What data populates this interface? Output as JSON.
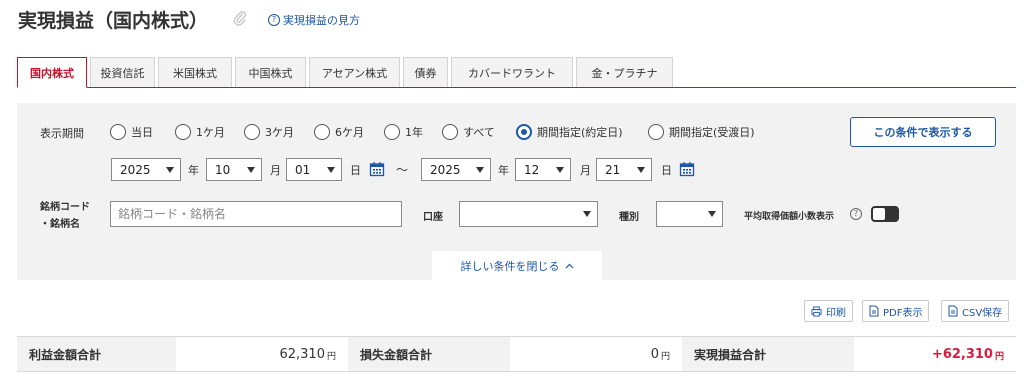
{
  "header": {
    "title": "実現損益（国内株式）",
    "help_link": "実現損益の見方"
  },
  "tabs": [
    {
      "label": "国内株式",
      "active": true
    },
    {
      "label": "投資信託"
    },
    {
      "label": "米国株式"
    },
    {
      "label": "中国株式"
    },
    {
      "label": "アセアン株式"
    },
    {
      "label": "債券"
    },
    {
      "label": "カバードワラント"
    },
    {
      "label": "金・プラチナ"
    }
  ],
  "filters": {
    "period_label": "表示期間",
    "period_options": [
      {
        "label": "当日",
        "selected": false
      },
      {
        "label": "1ケ月",
        "selected": false
      },
      {
        "label": "3ケ月",
        "selected": false
      },
      {
        "label": "6ケ月",
        "selected": false
      },
      {
        "label": "1年",
        "selected": false
      },
      {
        "label": "すべて",
        "selected": false
      },
      {
        "label": "期間指定(約定日)",
        "selected": true
      },
      {
        "label": "期間指定(受渡日)",
        "selected": false
      }
    ],
    "apply_button": "この条件で表示する",
    "date_from": {
      "year": "2025",
      "month": "10",
      "day": "01"
    },
    "date_to": {
      "year": "2025",
      "month": "12",
      "day": "21"
    },
    "unit_year": "年",
    "unit_month": "月",
    "unit_day": "日",
    "range_sep": "～",
    "symbol_label_1": "銘柄コード",
    "symbol_label_2": "・銘柄名",
    "symbol_placeholder": "銘柄コード・銘柄名",
    "account_label": "口座",
    "account_value": "",
    "category_label": "種別",
    "category_value": "",
    "decimal_label": "平均取得価額小数表示",
    "decimal_toggle_on": true,
    "collapse_label": "詳しい条件を閉じる"
  },
  "actions": {
    "print": "印刷",
    "pdf": "PDF表示",
    "csv": "CSV保存"
  },
  "summary": {
    "yen": "円",
    "profit_label": "利益金額合計",
    "profit_value": "62,310",
    "loss_label": "損失金額合計",
    "loss_value": "0",
    "realized_label": "実現損益合計",
    "realized_value": "+62,310"
  },
  "colors": {
    "accent_red": "#c4152c",
    "link_blue": "#1d57a8",
    "positive": "#d81b3f"
  }
}
